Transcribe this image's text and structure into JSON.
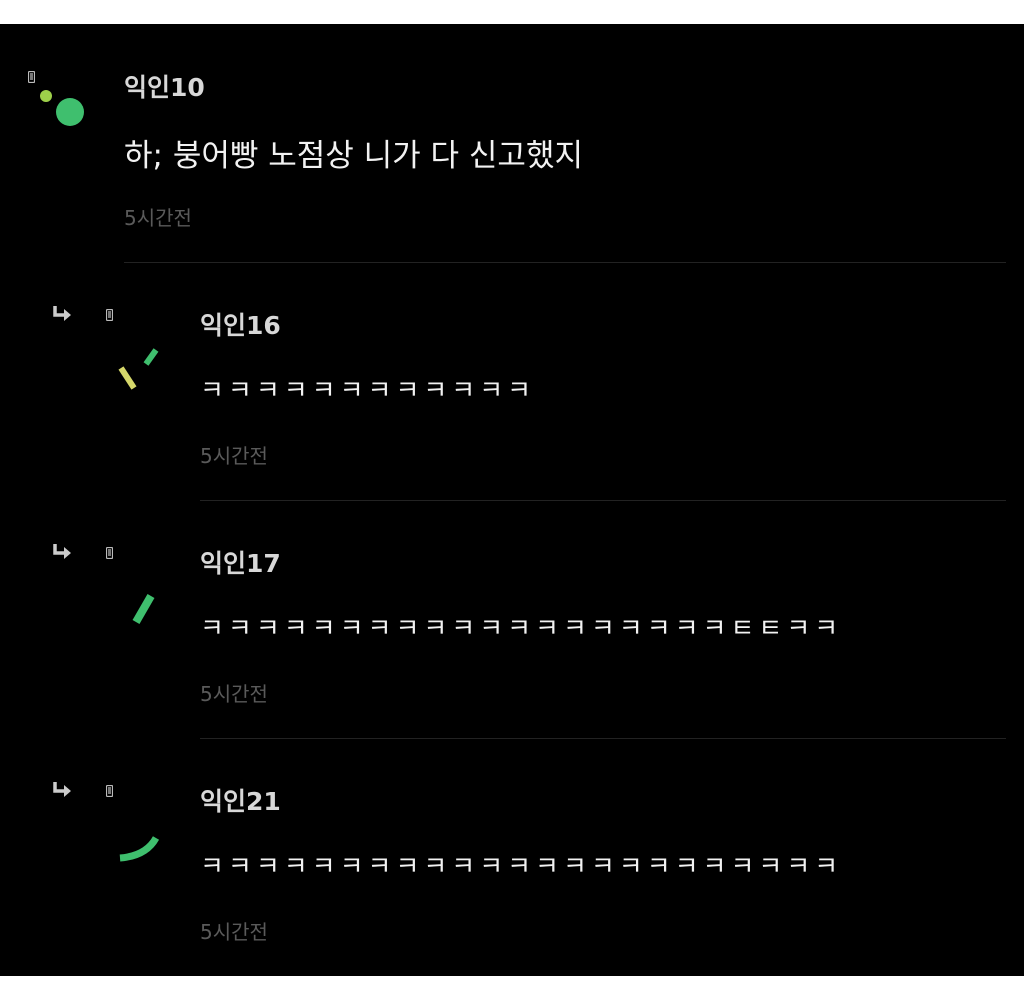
{
  "comments": [
    {
      "author": "익인10",
      "text": "하; 붕어빵 노점상 니가 다 신고했지",
      "time": "5시간전",
      "is_reply": false,
      "avatar_icon": "green-dots-avatar-icon"
    },
    {
      "author": "익인16",
      "text": "ㅋㅋㅋㅋㅋㅋㅋㅋㅋㅋㅋㅋ",
      "time": "5시간전",
      "is_reply": true,
      "avatar_icon": "green-yellow-dashes-avatar-icon"
    },
    {
      "author": "익인17",
      "text": "ㅋㅋㅋㅋㅋㅋㅋㅋㅋㅋㅋㅋㅋㅋㅋㅋㅋㅋㅋㅌㅌㅋㅋ",
      "time": "5시간전",
      "is_reply": true,
      "avatar_icon": "green-dash-avatar-icon"
    },
    {
      "author": "익인21",
      "text": "ㅋㅋㅋㅋㅋㅋㅋㅋㅋㅋㅋㅋㅋㅋㅋㅋㅋㅋㅋㅋㅋㅋㅋ",
      "time": "5시간전",
      "is_reply": true,
      "avatar_icon": "green-arc-avatar-icon"
    }
  ],
  "colors": {
    "background": "#000000",
    "avatar_green": "#3fbf6e",
    "avatar_light_green": "#9ed04a",
    "avatar_yellow": "#d6d86a"
  }
}
